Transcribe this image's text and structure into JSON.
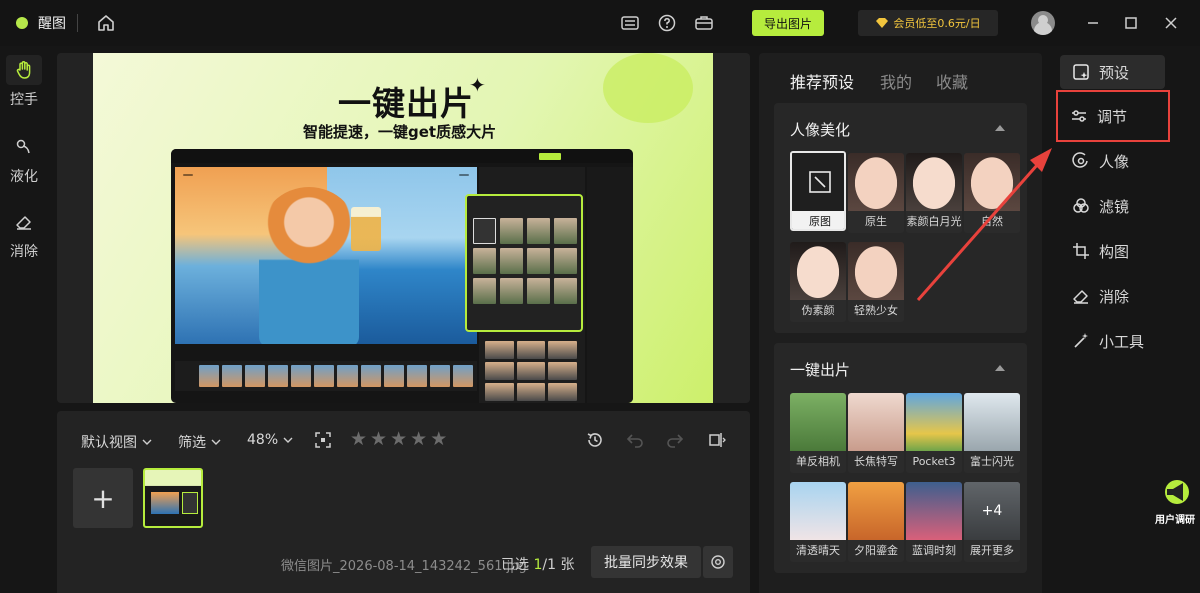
{
  "app": {
    "name": "醒图"
  },
  "titlebar": {
    "export_label": "导出图片",
    "vip_label": "会员低至0.6元/日"
  },
  "left_tools": [
    {
      "label": "控手",
      "icon": "hand-icon"
    },
    {
      "label": "液化",
      "icon": "liquify-icon"
    },
    {
      "label": "消除",
      "icon": "eraser-icon"
    }
  ],
  "canvas": {
    "poster_title": "一键出片",
    "poster_subtitle": "智能提速，一键get质感大片"
  },
  "filmstrip": {
    "view_label": "默认视图",
    "filter_label": "筛选",
    "zoom_label": "48%",
    "rating_max": 5,
    "filename": "微信图片_2026-08-14_143242_561.jpg",
    "selected_prefix": "已选",
    "selected_current": "1",
    "selected_total": "/1 张",
    "sync_label": "批量同步效果"
  },
  "presets": {
    "tabs": [
      "推荐预设",
      "我的",
      "收藏"
    ],
    "sections": [
      {
        "title": "人像美化",
        "items": [
          "原图",
          "原生",
          "素颜白月光",
          "自然",
          "伪素颜",
          "轻熟少女"
        ]
      },
      {
        "title": "一键出片",
        "items": [
          "单反相机",
          "长焦特写",
          "Pocket3",
          "富士闪光",
          "清透晴天",
          "夕阳鎏金",
          "蓝调时刻",
          "展开更多"
        ],
        "more_badge": "+4"
      }
    ]
  },
  "right_rail": [
    {
      "label": "预设",
      "icon": "preset-icon"
    },
    {
      "label": "调节",
      "icon": "sliders-icon"
    },
    {
      "label": "人像",
      "icon": "portrait-icon"
    },
    {
      "label": "滤镜",
      "icon": "filter-icon"
    },
    {
      "label": "构图",
      "icon": "crop-icon"
    },
    {
      "label": "消除",
      "icon": "eraser-icon"
    },
    {
      "label": "小工具",
      "icon": "magic-wand-icon"
    }
  ],
  "float_button": {
    "label": "用户调研"
  },
  "colors": {
    "accent": "#b6ec3d",
    "highlight": "#e8423c",
    "vip": "#f2c53d"
  }
}
